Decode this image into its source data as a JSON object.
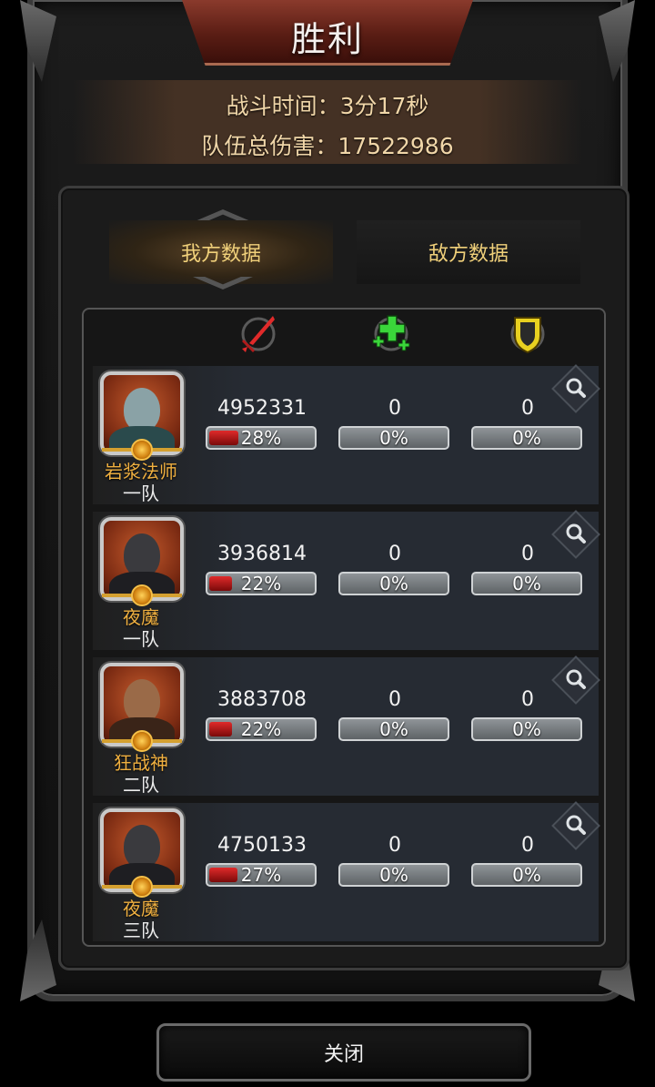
{
  "title": "胜利",
  "stats": {
    "battle_time": "战斗时间：3分17秒",
    "team_damage": "队伍总伤害：17522986"
  },
  "tabs": {
    "mine": "我方数据",
    "enemy": "敌方数据"
  },
  "columns": {
    "damage_icon": "sword-icon",
    "heal_icon": "heal-cross-icon",
    "defense_icon": "shield-icon"
  },
  "rows": [
    {
      "name": "岩浆法师",
      "team": "一队",
      "damage": "4952331",
      "damage_pct": "28%",
      "damage_fill": 0.28,
      "heal": "0",
      "heal_pct": "0%",
      "defense": "0",
      "defense_pct": "0%"
    },
    {
      "name": "夜魔",
      "team": "一队",
      "damage": "3936814",
      "damage_pct": "22%",
      "damage_fill": 0.22,
      "heal": "0",
      "heal_pct": "0%",
      "defense": "0",
      "defense_pct": "0%"
    },
    {
      "name": "狂战神",
      "team": "二队",
      "damage": "3883708",
      "damage_pct": "22%",
      "damage_fill": 0.22,
      "heal": "0",
      "heal_pct": "0%",
      "defense": "0",
      "defense_pct": "0%"
    },
    {
      "name": "夜魔",
      "team": "三队",
      "damage": "4750133",
      "damage_pct": "27%",
      "damage_fill": 0.27,
      "heal": "0",
      "heal_pct": "0%",
      "defense": "0",
      "defense_pct": "0%"
    }
  ],
  "close_label": "关闭",
  "colors": {
    "accent_gold": "#f0d07a",
    "name_orange": "#f0b040",
    "damage_red": "#e02a2a",
    "heal_green": "#3ad63a",
    "shield_yellow": "#e8d020"
  }
}
